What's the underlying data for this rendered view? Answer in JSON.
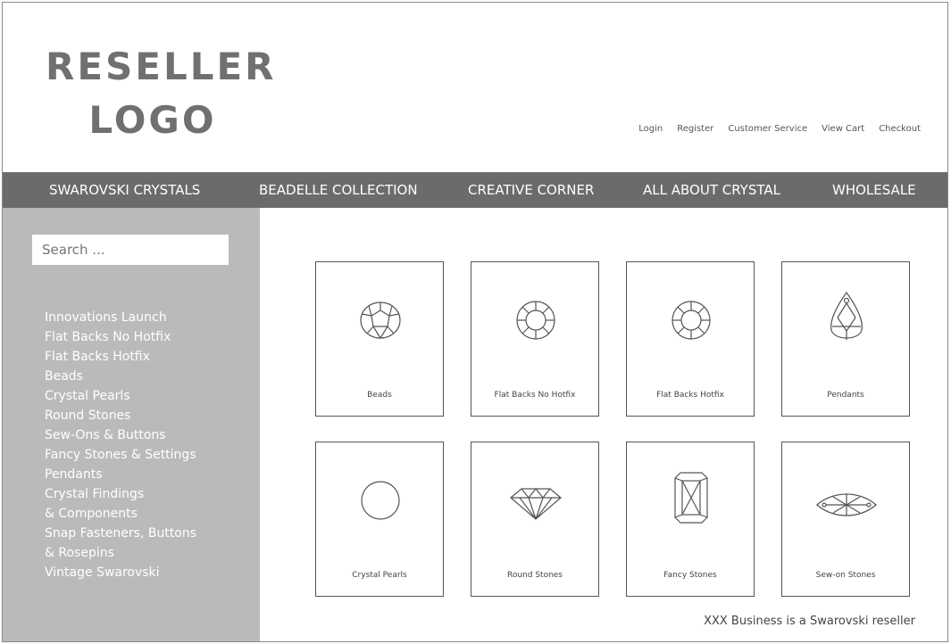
{
  "logo": {
    "line1": "RESELLER",
    "line2": "LOGO"
  },
  "utility_links": [
    "Login",
    "Register",
    "Customer Service",
    "View Cart",
    "Checkout"
  ],
  "nav": [
    "SWAROVSKI CRYSTALS",
    "BEADELLE COLLECTION",
    "CREATIVE CORNER",
    "ALL ABOUT CRYSTAL",
    "WHOLESALE"
  ],
  "search": {
    "placeholder": "Search ..."
  },
  "categories": [
    "Innovations Launch",
    "Flat Backs No Hotfix",
    "Flat Backs Hotfix",
    "Beads",
    "Crystal Pearls",
    "Round Stones",
    "Sew-Ons & Buttons",
    "Fancy Stones & Settings",
    "Pendants",
    "Crystal Findings",
    "& Components",
    "Snap Fasteners, Buttons",
    "& Rosepins",
    "Vintage Swarovski"
  ],
  "products": [
    {
      "label": "Beads",
      "icon": "bead-icon"
    },
    {
      "label": "Flat Backs No Hotfix",
      "icon": "flat-back-icon"
    },
    {
      "label": "Flat Backs Hotfix",
      "icon": "flat-back-hotfix-icon"
    },
    {
      "label": "Pendants",
      "icon": "pendant-icon"
    },
    {
      "label": "Crystal Pearls",
      "icon": "pearl-icon"
    },
    {
      "label": "Round Stones",
      "icon": "round-stone-icon"
    },
    {
      "label": "Fancy Stones",
      "icon": "fancy-stone-icon"
    },
    {
      "label": "Sew-on Stones",
      "icon": "sew-on-stone-icon"
    }
  ],
  "footer_note": "XXX Business is a Swarovski reseller"
}
